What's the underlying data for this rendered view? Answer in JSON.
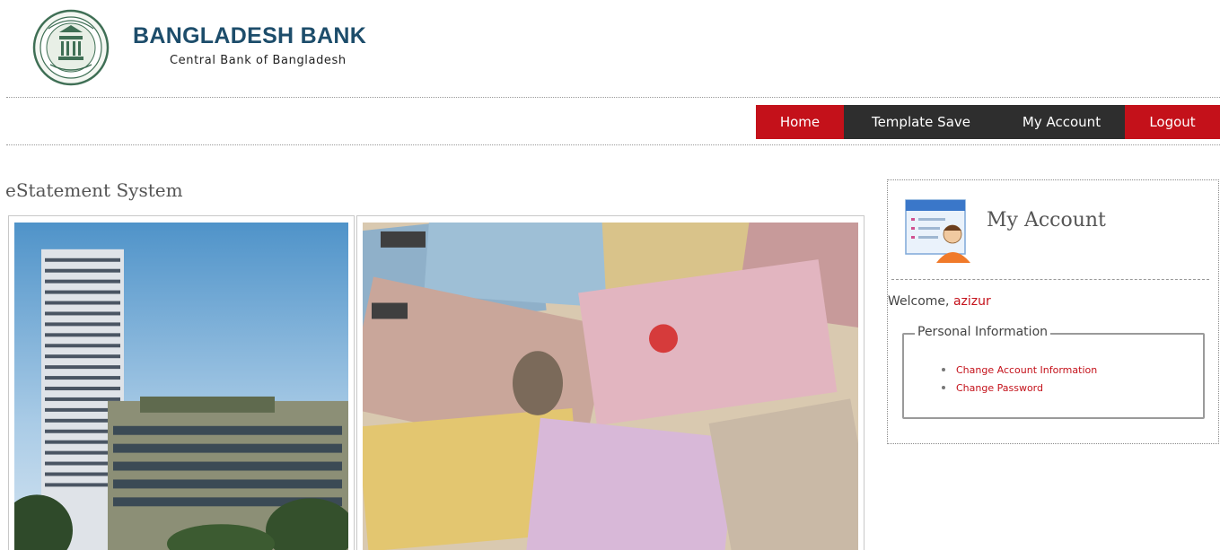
{
  "brand": {
    "title": "BANGLADESH BANK",
    "subtitle": "Central Bank of Bangladesh",
    "logo_icon": "bangladesh-bank-seal",
    "color": "#1d4d6b"
  },
  "nav": {
    "home": "Home",
    "template_save": "Template Save",
    "my_account": "My Account",
    "logout": "Logout",
    "accent_red": "#c4111a",
    "dark": "#2e2e2e"
  },
  "main": {
    "title": "eStatement System",
    "images": [
      "bank-building-photo",
      "banknotes-collage-photo"
    ]
  },
  "account": {
    "title": "My Account",
    "icon": "user-profile-card-icon",
    "welcome_prefix": "Welcome,",
    "username": "azizur",
    "personal_info": {
      "legend": "Personal Information",
      "links": [
        "Change Account Information",
        "Change Password"
      ]
    }
  }
}
